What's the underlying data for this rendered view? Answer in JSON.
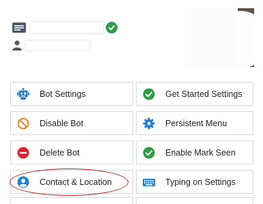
{
  "colors": {
    "accent_blue": "#1f7ed8",
    "green": "#2e9b45",
    "orange": "#e98a2f",
    "red": "#d7272f",
    "highlight_red": "#c0181c",
    "border": "#d6d6d6"
  },
  "page": {
    "id_icon": "id-card-icon",
    "user_icon": "user-icon",
    "verified_icon": "verified-check-icon"
  },
  "buttons": [
    {
      "label": "Bot Settings",
      "icon": "robot-icon"
    },
    {
      "label": "Get Started Settings",
      "icon": "check-circle-icon"
    },
    {
      "label": "Disable Bot",
      "icon": "ban-icon"
    },
    {
      "label": "Persistent Menu",
      "icon": "gear-icon"
    },
    {
      "label": "Delete Bot",
      "icon": "minus-circle-icon"
    },
    {
      "label": "Enable Mark Seen",
      "icon": "check-circle-icon"
    },
    {
      "label": "Contact & Location",
      "icon": "user-circle-icon"
    },
    {
      "label": "Typing on Settings",
      "icon": "keyboard-icon"
    }
  ]
}
